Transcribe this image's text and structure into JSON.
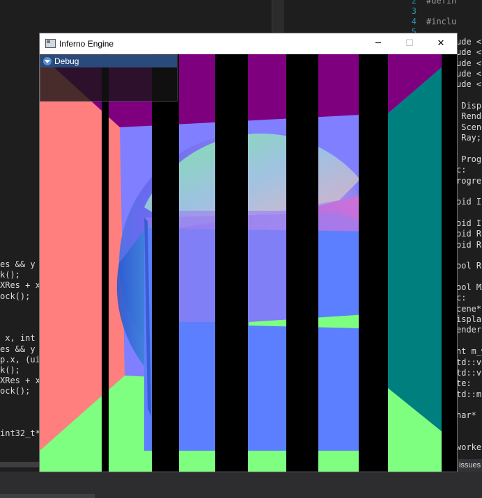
{
  "ide": {
    "right_top_lines": [
      {
        "num": "2",
        "code": "#define In"
      },
      {
        "num": "3",
        "code": ""
      },
      {
        "num": "4",
        "code": "#include \""
      },
      {
        "num": "5",
        "code": ""
      }
    ],
    "right_lines": [
      "ude <s",
      "ude <v",
      "ude <o",
      "ude <c",
      "ude <n",
      "",
      " Displ",
      " Rende",
      " Scene",
      " Ray;",
      "",
      " Progr",
      "c:",
      "rogres",
      "",
      "oid In",
      "",
      "oid In",
      "oid Re",
      "oid Re",
      "",
      "ool Re",
      "",
      "ool MX",
      "c:",
      "cene*",
      "isplay",
      "ender",
      "",
      "nt m_w",
      "td::ve",
      "td::ve",
      "te:",
      "td::mu",
      "",
      "har* b",
      "",
      "",
      "worker"
    ],
    "left_lines": [
      "es && y >",
      "k();",
      "XRes + x]",
      "ock();",
      "",
      "",
      "",
      " x, int y",
      "es && y >",
      "p.x, (uin",
      "k();",
      "XRes + x]",
      "ock();",
      "",
      "",
      "",
      "int32_t*"
    ],
    "issues_label": "issues"
  },
  "window": {
    "title": "Inferno Engine",
    "minimize_glyph": "─",
    "maximize_glyph": "☐",
    "close_glyph": "✕"
  },
  "debug_panel": {
    "title": "Debug"
  },
  "colors": {
    "pink": "#ff7f7f",
    "lavender": "#7f7fff",
    "purple": "#7f007f",
    "teal": "#007f7f",
    "green": "#7fff7f",
    "blue": "#5b7fff",
    "black": "#000000"
  }
}
